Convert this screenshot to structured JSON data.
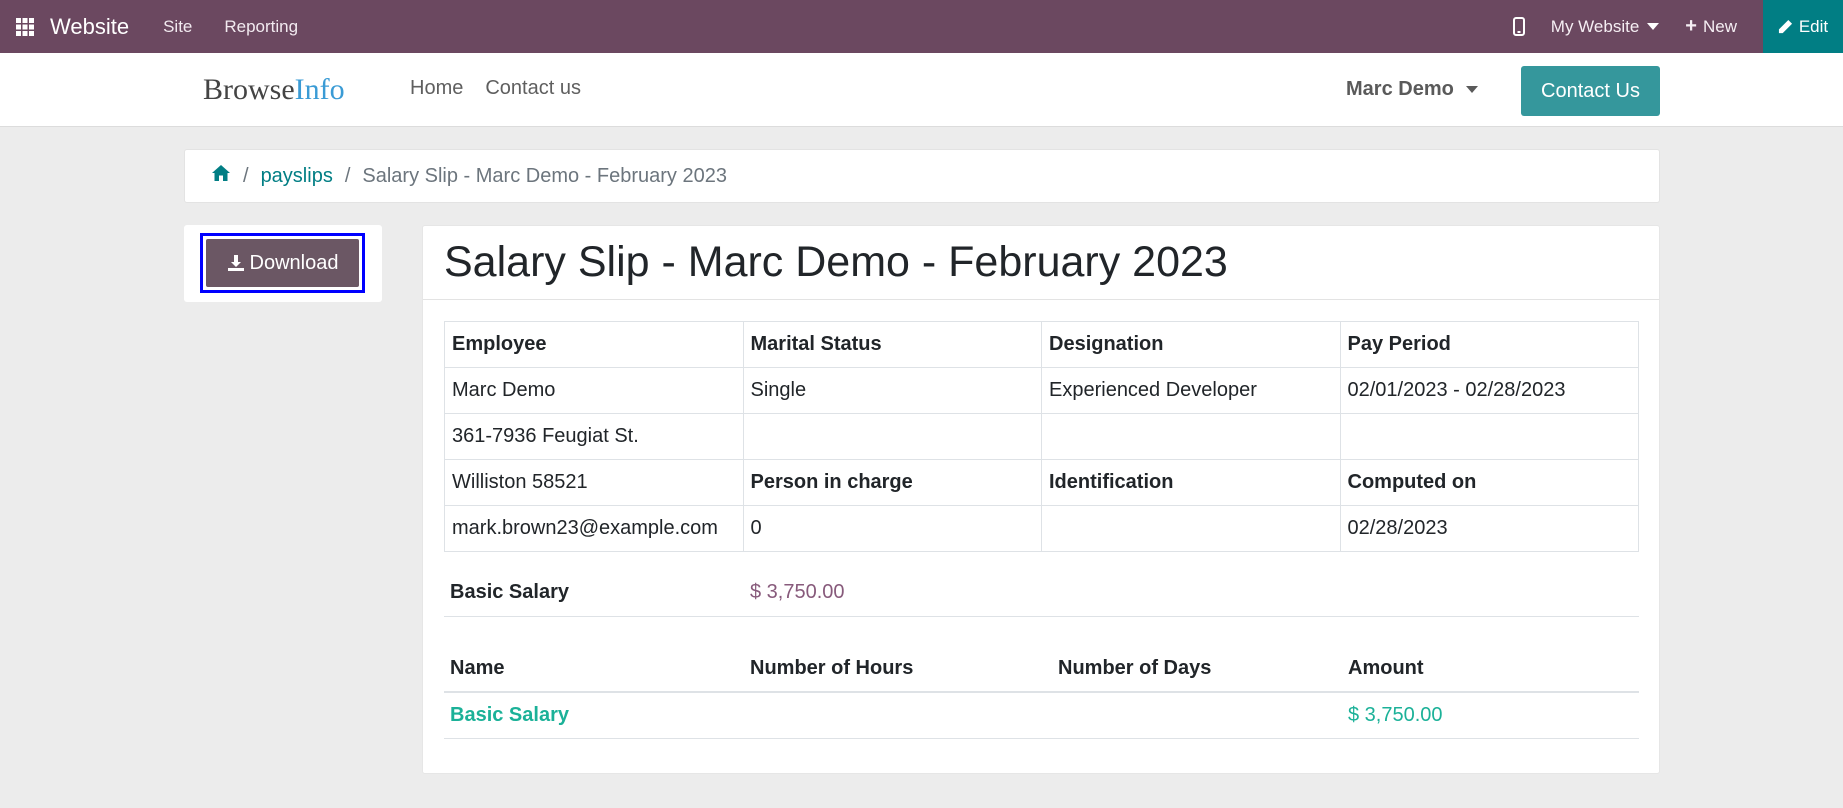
{
  "admin_bar": {
    "app_name": "Website",
    "menu": [
      "Site",
      "Reporting"
    ],
    "website_selector": "My Website",
    "new_label": "New",
    "edit_label": "Edit",
    "colors": {
      "bar": "#6b4860",
      "edit": "#017e84"
    }
  },
  "site_header": {
    "logo_part1": "Browse",
    "logo_part2": "Info",
    "nav": [
      "Home",
      "Contact us"
    ],
    "user": "Marc Demo",
    "contact_button": "Contact Us"
  },
  "breadcrumb": {
    "home_icon": "home-icon",
    "link": "payslips",
    "current": "Salary Slip - Marc Demo - February 2023"
  },
  "actions": {
    "download_label": "Download"
  },
  "payslip": {
    "title": "Salary Slip - Marc Demo - February 2023",
    "info_rows": [
      [
        "Employee",
        "Marital Status",
        "Designation",
        "Pay Period"
      ],
      [
        "Marc Demo",
        "Single",
        "Experienced Developer",
        "02/01/2023 - 02/28/2023"
      ],
      [
        "361-7936 Feugiat St.",
        "",
        "",
        ""
      ],
      [
        "Williston 58521",
        "Person in charge",
        "Identification",
        "Computed on"
      ],
      [
        "mark.brown23@example.com",
        "0",
        "",
        "02/28/2023"
      ]
    ],
    "basic_salary_label": "Basic Salary",
    "basic_salary_value": "$ 3,750.00",
    "lines_headers": [
      "Name",
      "Number of Hours",
      "Number of Days",
      "Amount"
    ],
    "lines": [
      {
        "name": "Basic Salary",
        "hours": "",
        "days": "",
        "amount": "$ 3,750.00"
      }
    ]
  }
}
